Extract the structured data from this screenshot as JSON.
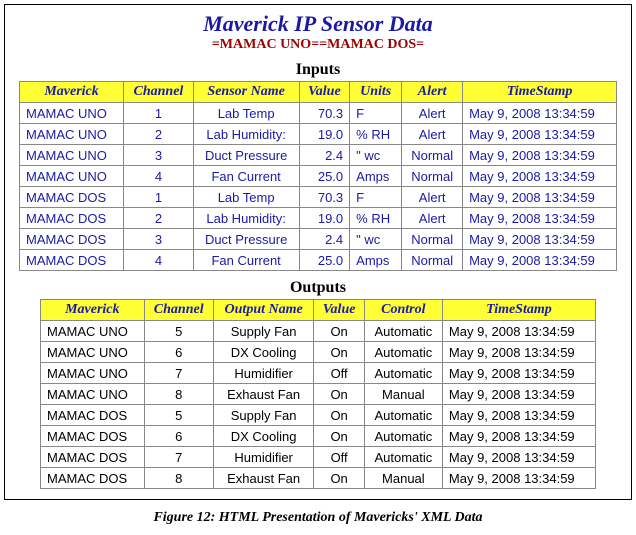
{
  "title": "Maverick IP Sensor Data",
  "subtitle": "=MAMAC UNO==MAMAC DOS=",
  "inputs": {
    "heading": "Inputs",
    "columns": [
      "Maverick",
      "Channel",
      "Sensor Name",
      "Value",
      "Units",
      "Alert",
      "TimeStamp"
    ],
    "rows": [
      {
        "maverick": "MAMAC UNO",
        "channel": "1",
        "sensor": "Lab Temp",
        "value": "70.3",
        "units": "F",
        "alert": "Alert",
        "timestamp": "May 9, 2008 13:34:59"
      },
      {
        "maverick": "MAMAC UNO",
        "channel": "2",
        "sensor": "Lab Humidity:",
        "value": "19.0",
        "units": "% RH",
        "alert": "Alert",
        "timestamp": "May 9, 2008 13:34:59"
      },
      {
        "maverick": "MAMAC UNO",
        "channel": "3",
        "sensor": "Duct Pressure",
        "value": "2.4",
        "units": "\" wc",
        "alert": "Normal",
        "timestamp": "May 9, 2008 13:34:59"
      },
      {
        "maverick": "MAMAC UNO",
        "channel": "4",
        "sensor": "Fan Current",
        "value": "25.0",
        "units": "Amps",
        "alert": "Normal",
        "timestamp": "May 9, 2008 13:34:59"
      },
      {
        "maverick": "MAMAC DOS",
        "channel": "1",
        "sensor": "Lab Temp",
        "value": "70.3",
        "units": "F",
        "alert": "Alert",
        "timestamp": "May 9, 2008 13:34:59"
      },
      {
        "maverick": "MAMAC DOS",
        "channel": "2",
        "sensor": "Lab Humidity:",
        "value": "19.0",
        "units": "% RH",
        "alert": "Alert",
        "timestamp": "May 9, 2008 13:34:59"
      },
      {
        "maverick": "MAMAC DOS",
        "channel": "3",
        "sensor": "Duct Pressure",
        "value": "2.4",
        "units": "\" wc",
        "alert": "Normal",
        "timestamp": "May 9, 2008 13:34:59"
      },
      {
        "maverick": "MAMAC DOS",
        "channel": "4",
        "sensor": "Fan Current",
        "value": "25.0",
        "units": "Amps",
        "alert": "Normal",
        "timestamp": "May 9, 2008 13:34:59"
      }
    ]
  },
  "outputs": {
    "heading": "Outputs",
    "columns": [
      "Maverick",
      "Channel",
      "Output Name",
      "Value",
      "Control",
      "TimeStamp"
    ],
    "rows": [
      {
        "maverick": "MAMAC UNO",
        "channel": "5",
        "output": "Supply Fan",
        "value": "On",
        "control": "Automatic",
        "timestamp": "May 9, 2008 13:34:59"
      },
      {
        "maverick": "MAMAC UNO",
        "channel": "6",
        "output": "DX Cooling",
        "value": "On",
        "control": "Automatic",
        "timestamp": "May 9, 2008 13:34:59"
      },
      {
        "maverick": "MAMAC UNO",
        "channel": "7",
        "output": "Humidifier",
        "value": "Off",
        "control": "Automatic",
        "timestamp": "May 9, 2008 13:34:59"
      },
      {
        "maverick": "MAMAC UNO",
        "channel": "8",
        "output": "Exhaust Fan",
        "value": "On",
        "control": "Manual",
        "timestamp": "May 9, 2008 13:34:59"
      },
      {
        "maverick": "MAMAC DOS",
        "channel": "5",
        "output": "Supply Fan",
        "value": "On",
        "control": "Automatic",
        "timestamp": "May 9, 2008 13:34:59"
      },
      {
        "maverick": "MAMAC DOS",
        "channel": "6",
        "output": "DX Cooling",
        "value": "On",
        "control": "Automatic",
        "timestamp": "May 9, 2008 13:34:59"
      },
      {
        "maverick": "MAMAC DOS",
        "channel": "7",
        "output": "Humidifier",
        "value": "Off",
        "control": "Automatic",
        "timestamp": "May 9, 2008 13:34:59"
      },
      {
        "maverick": "MAMAC DOS",
        "channel": "8",
        "output": "Exhaust Fan",
        "value": "On",
        "control": "Manual",
        "timestamp": "May 9, 2008 13:34:59"
      }
    ]
  },
  "figure_caption": "Figure 12:  HTML Presentation of Mavericks' XML Data"
}
